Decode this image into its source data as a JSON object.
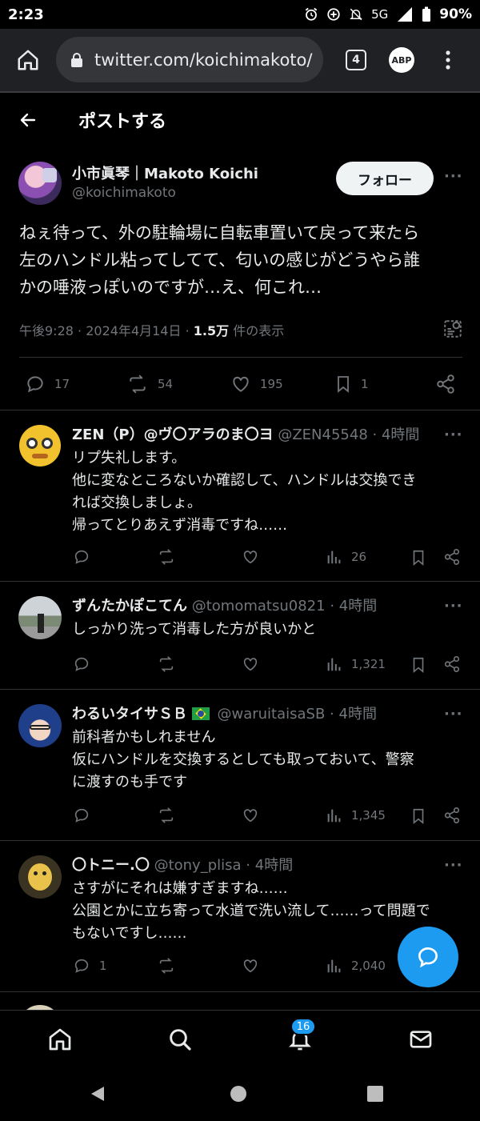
{
  "status_bar": {
    "time": "2:23",
    "network": "5G",
    "battery": "90%"
  },
  "browser": {
    "url": "twitter.com/koichimakoto/",
    "tab_count": "4",
    "adblock_label": "ABP"
  },
  "header": {
    "title": "ポストする"
  },
  "main_tweet": {
    "display_name": "小市眞琴｜Makoto Koichi",
    "handle": "@koichimakoto",
    "follow_label": "フォロー",
    "text_lines": [
      "ねぇ待って、外の駐輪場に自転車置いて戻って来たら",
      "左のハンドル粘ってしてて、匂いの感じがどうやら誰",
      "かの唾液っぽいのですが…え、何これ…"
    ],
    "time": "午後9:28",
    "date": "2024年4月14日",
    "views_count": "1.5万",
    "views_label": "件の表示",
    "replies": "17",
    "reposts": "54",
    "likes": "195",
    "bookmarks": "1"
  },
  "replies": [
    {
      "display_name": "ZEN（P）@ヴ〇アラのま〇ヨ",
      "handle": "@ZEN45548",
      "time": "4時間",
      "lines": [
        "リプ失礼します。",
        "他に変なところないか確認して、ハンドルは交換でき",
        "れば交換しましょ。",
        "帰ってとりあえず消毒ですね……"
      ],
      "reply_count": "",
      "views": "26"
    },
    {
      "display_name": "ずんたかぽこてん",
      "handle": "@tomomatsu0821",
      "time": "4時間",
      "lines": [
        "しっかり洗って消毒した方が良いかと"
      ],
      "reply_count": "",
      "views": "1,321"
    },
    {
      "display_name": "わるいタイサＳＢ",
      "handle": "@waruitaisaSB",
      "time": "4時間",
      "lines": [
        "前科者かもしれません",
        "仮にハンドルを交換するとしても取っておいて、警察",
        "に渡すのも手です"
      ],
      "reply_count": "",
      "views": "1,345"
    },
    {
      "display_name": "〇トニー.〇",
      "handle": "@tony_plisa",
      "time": "4時間",
      "lines": [
        "さすがにそれは嫌すぎますね……",
        "公園とかに立ち寄って水道で洗い流して……って問題で",
        "もないですし……"
      ],
      "reply_count": "1",
      "views": "2,040"
    }
  ],
  "sep": "·",
  "more_dots": "···",
  "bottom_nav": {
    "notifications_badge": "16"
  },
  "colors": {
    "accent": "#1d9bf0",
    "background": "#000000",
    "text": "#e7e9ea",
    "secondary": "#71767b",
    "divider": "#2f3336"
  }
}
